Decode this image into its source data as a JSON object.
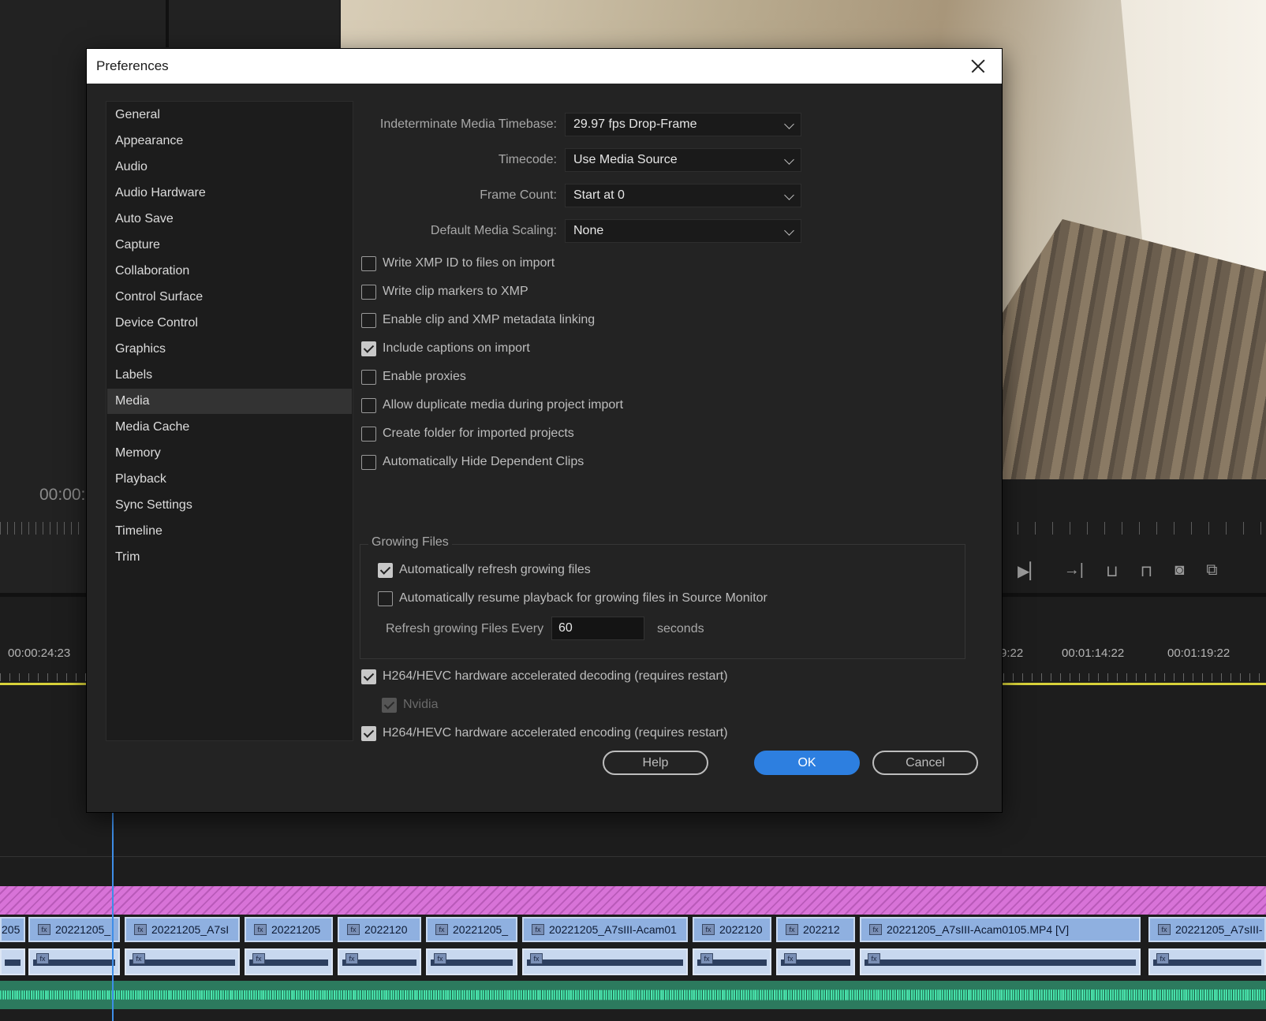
{
  "dialog": {
    "title": "Preferences",
    "nav": {
      "items": [
        {
          "label": "General"
        },
        {
          "label": "Appearance"
        },
        {
          "label": "Audio"
        },
        {
          "label": "Audio Hardware"
        },
        {
          "label": "Auto Save"
        },
        {
          "label": "Capture"
        },
        {
          "label": "Collaboration"
        },
        {
          "label": "Control Surface"
        },
        {
          "label": "Device Control"
        },
        {
          "label": "Graphics"
        },
        {
          "label": "Labels"
        },
        {
          "label": "Media"
        },
        {
          "label": "Media Cache"
        },
        {
          "label": "Memory"
        },
        {
          "label": "Playback"
        },
        {
          "label": "Sync Settings"
        },
        {
          "label": "Timeline"
        },
        {
          "label": "Trim"
        }
      ],
      "selected": "Media"
    },
    "media": {
      "timebase": {
        "label": "Indeterminate Media Timebase:",
        "value": "29.97 fps Drop-Frame"
      },
      "timecode": {
        "label": "Timecode:",
        "value": "Use Media Source"
      },
      "frame_count": {
        "label": "Frame Count:",
        "value": "Start at 0"
      },
      "scaling": {
        "label": "Default Media Scaling:",
        "value": "None"
      },
      "checkboxes": [
        {
          "label": "Write XMP ID to files on import",
          "checked": false
        },
        {
          "label": "Write clip markers to XMP",
          "checked": false
        },
        {
          "label": "Enable clip and XMP metadata linking",
          "checked": false
        },
        {
          "label": "Include captions on import",
          "checked": true
        },
        {
          "label": "Enable proxies",
          "checked": false
        },
        {
          "label": "Allow duplicate media during project import",
          "checked": false
        },
        {
          "label": "Create folder for imported projects",
          "checked": false
        },
        {
          "label": "Automatically Hide Dependent Clips",
          "checked": false
        }
      ],
      "growing_files": {
        "title": "Growing Files",
        "auto_refresh": {
          "label": "Automatically refresh growing files",
          "checked": true
        },
        "auto_resume": {
          "label": "Automatically resume playback for growing files in Source Monitor",
          "checked": false
        },
        "refresh_label": "Refresh growing Files Every",
        "refresh_value": "60",
        "refresh_unit": "seconds"
      },
      "hw_decoding": {
        "label": "H264/HEVC hardware accelerated decoding (requires restart)",
        "checked": true
      },
      "nvidia": {
        "label": "Nvidia",
        "checked": true,
        "disabled": true
      },
      "hw_encoding": {
        "label": "H264/HEVC hardware accelerated encoding (requires restart)",
        "checked": true
      }
    },
    "buttons": {
      "help": "Help",
      "ok": "OK",
      "cancel": "Cancel"
    },
    "colors": {
      "accent": "#2d7fe0",
      "background": "#232323",
      "titlebar": "#ffffff"
    }
  },
  "background": {
    "source_timecode": "00:00:",
    "ruler": [
      "00:00:24:23",
      "9:22",
      "00:01:14:22",
      "00:01:19:22"
    ],
    "clips": [
      "205",
      "20221205_",
      "20221205_A7sI",
      "20221205",
      "2022120",
      "20221205_",
      "20221205_A7sIII-Acam01",
      "2022120",
      "202212",
      "20221205_A7sIII-Acam0105.MP4 [V]",
      "20221205_A7sIII-"
    ],
    "icons": [
      "step-forward-icon",
      "go-to-out-icon",
      "insert-icon",
      "overwrite-icon",
      "camera-icon",
      "compare-icon"
    ],
    "colors": {
      "playhead": "#3e8ee8",
      "ruler_line": "#d8d23a",
      "clip": "#8fb0e0",
      "audio": "#3fd6a0",
      "adjustment": "#d873d8"
    }
  }
}
